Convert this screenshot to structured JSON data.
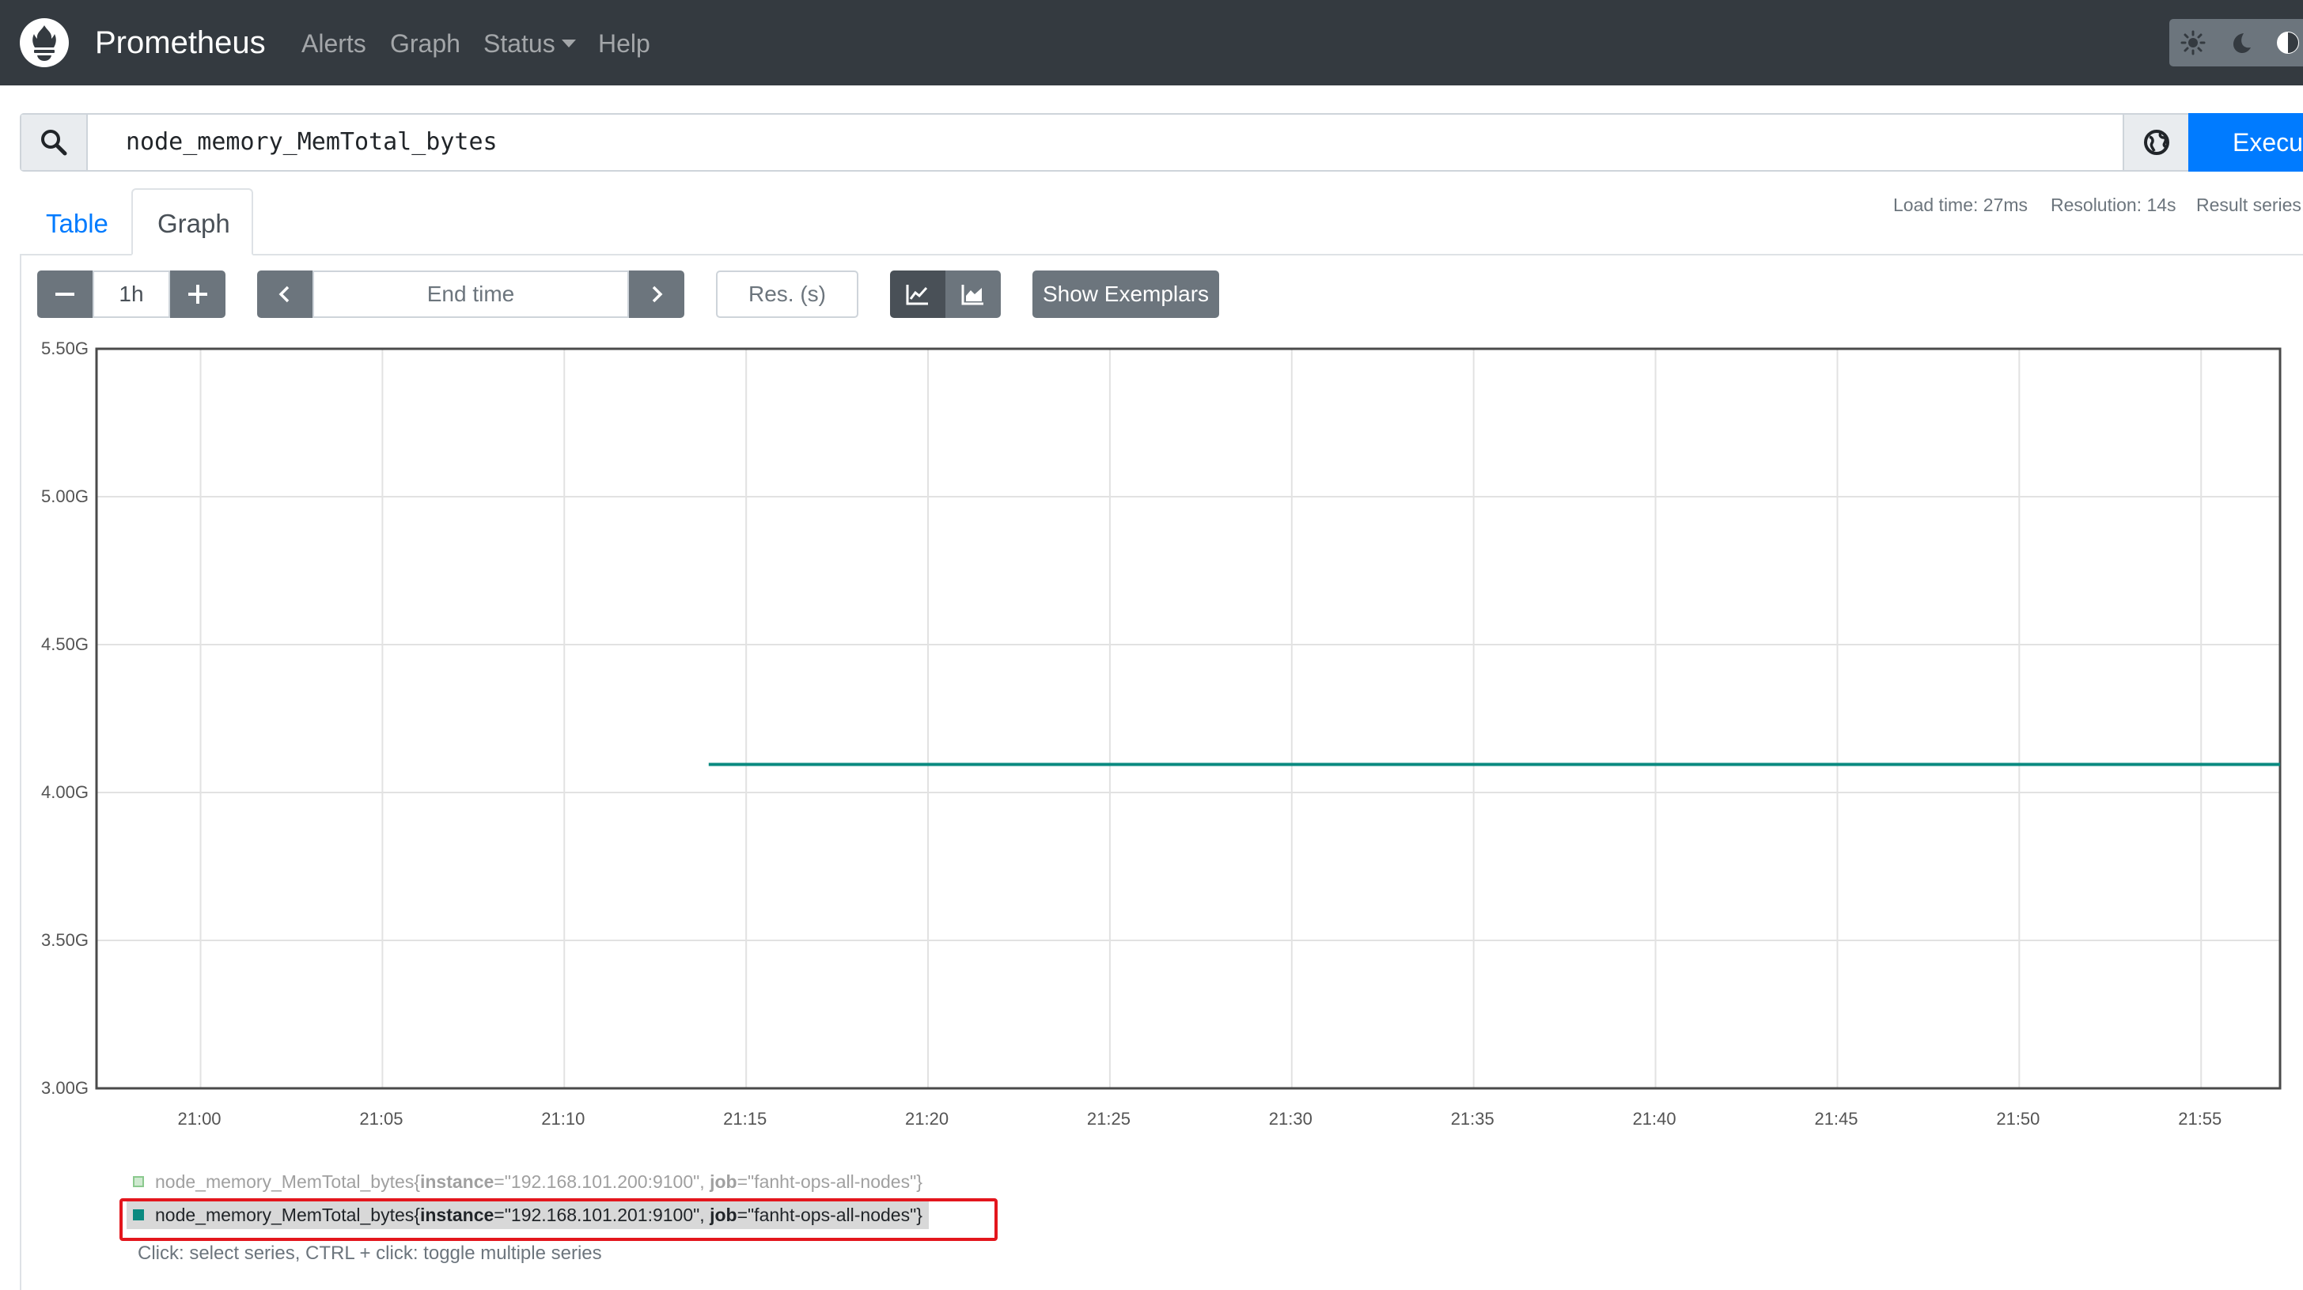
{
  "navbar": {
    "brand": "Prometheus",
    "links": [
      "Alerts",
      "Graph",
      "Status",
      "Help"
    ],
    "theme_icons": [
      "sun-icon",
      "moon-icon",
      "contrast-icon"
    ]
  },
  "query": {
    "expression": "node_memory_MemTotal_bytes",
    "execute_label": "Execute"
  },
  "tabs": {
    "table": "Table",
    "graph": "Graph",
    "active": "Graph"
  },
  "stats": {
    "load_time": "Load time: 27ms",
    "resolution": "Resolution: 14s",
    "result_series": "Result series:"
  },
  "controls": {
    "range": "1h",
    "end_time_placeholder": "End time",
    "resolution_placeholder": "Res. (s)",
    "show_exemplars": "Show Exemplars",
    "chart_mode": "line"
  },
  "chart_data": {
    "type": "line",
    "y_tick_labels": [
      "5.50G",
      "5.00G",
      "4.50G",
      "4.00G",
      "3.50G",
      "3.00G"
    ],
    "ylim": [
      3.0,
      5.5
    ],
    "x_tick_labels": [
      "21:00",
      "21:05",
      "21:10",
      "21:15",
      "21:20",
      "21:25",
      "21:30",
      "21:35",
      "21:40",
      "21:45",
      "21:50",
      "21:55"
    ],
    "x_range_minutes": [
      -2.86,
      57.17
    ],
    "grid": true,
    "series": [
      {
        "metric": "node_memory_MemTotal_bytes",
        "instance": "192.168.101.200:9100",
        "job": "fanht-ops-all-nodes",
        "color": "#8bc98e",
        "visible": false,
        "points": []
      },
      {
        "metric": "node_memory_MemTotal_bytes",
        "instance": "192.168.101.201:9100",
        "job": "fanht-ops-all-nodes",
        "color": "#0a8a80",
        "visible": true,
        "points": [
          [
            13.97,
            4.095
          ],
          [
            57.17,
            4.095
          ]
        ]
      }
    ]
  },
  "legend": {
    "items": [
      {
        "metric": "node_memory_MemTotal_bytes",
        "instance_label": "instance",
        "instance": "\"192.168.101.200:9100\"",
        "job_label": "job",
        "job": "\"fanht-ops-all-nodes\"",
        "color": "#8bc98e"
      },
      {
        "metric": "node_memory_MemTotal_bytes",
        "instance_label": "instance",
        "instance": "\"192.168.101.201:9100\"",
        "job_label": "job",
        "job": "\"fanht-ops-all-nodes\"",
        "color": "#0a8a80"
      }
    ],
    "help": "Click: select series, CTRL + click: toggle multiple series"
  },
  "colors": {
    "navbar_bg": "#343a40",
    "primary": "#007bff",
    "secondary": "#6c757d",
    "highlight": "#e3161d"
  }
}
